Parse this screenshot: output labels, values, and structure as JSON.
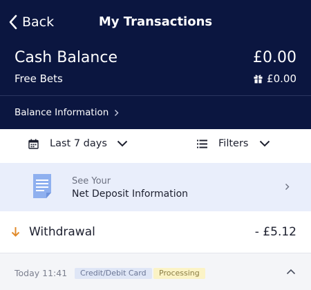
{
  "nav": {
    "back_label": "Back",
    "title": "My Transactions"
  },
  "balance": {
    "cash_label": "Cash Balance",
    "cash_value": "£0.00",
    "free_bets_label": "Free Bets",
    "free_bets_value": "£0.00",
    "info_link": "Balance Information"
  },
  "filters": {
    "date_label": "Last 7 days",
    "filters_label": "Filters"
  },
  "deposit_banner": {
    "line1": "See Your",
    "line2": "Net Deposit Information"
  },
  "transaction": {
    "type": "Withdrawal",
    "amount": "- £5.12",
    "time": "Today 11:41",
    "method": "Credit/Debit Card",
    "status": "Processing"
  },
  "icons": {
    "back": "chevron-left-icon",
    "gift": "gift-icon",
    "calendar": "calendar-icon",
    "filter": "list-icon",
    "document": "document-icon",
    "withdrawal": "arrow-down-icon",
    "collapse": "chevron-up-icon"
  },
  "colors": {
    "header_bg": "#0b1640",
    "banner_bg": "#e9eefb",
    "withdrawal_arrow": "#e08a2a",
    "processing_bg": "#fbf3c6",
    "method_bg": "#dfe6f6"
  }
}
